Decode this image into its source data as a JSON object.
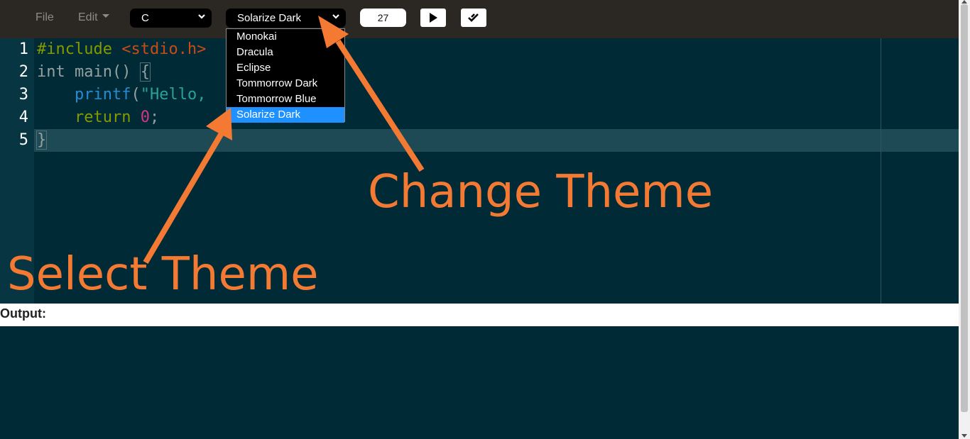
{
  "menu": {
    "file": "File",
    "edit": "Edit"
  },
  "language_select": {
    "value": "C"
  },
  "theme_select": {
    "value": "Solarize Dark",
    "options": [
      "Monokai",
      "Dracula",
      "Eclipse",
      "Tommorrow Dark",
      "Tommorrow Blue",
      "Solarize Dark"
    ],
    "selected_index": 5
  },
  "font_size": "27",
  "buttons": {
    "run_icon": "play-icon",
    "check_icon": "check-all-icon"
  },
  "editor": {
    "line_numbers": [
      "1",
      "2",
      "3",
      "4",
      "5"
    ],
    "active_line": 5,
    "code": {
      "l1_directive": "#include",
      "l1_header": " <stdio.h>",
      "l2_type": "int",
      "l2_rest": " main() ",
      "l2_brace": "{",
      "l3_indent": "    ",
      "l3_fn": "printf",
      "l3_paren": "(",
      "l3_str": "\"Hello,",
      "l4_indent": "    ",
      "l4_kw": "return",
      "l4_space": " ",
      "l4_num": "0",
      "l4_semi": ";",
      "l5_brace": "}"
    }
  },
  "output": {
    "label": "Output:"
  },
  "annotations": {
    "change_theme": "Change Theme",
    "select_theme": "Select Theme"
  },
  "colors": {
    "toolbar": "#2b2824",
    "editor_bg": "#002b36",
    "gutter_bg": "#073642",
    "annotation": "#f47a33",
    "dropdown_selected": "#1e90ff"
  }
}
